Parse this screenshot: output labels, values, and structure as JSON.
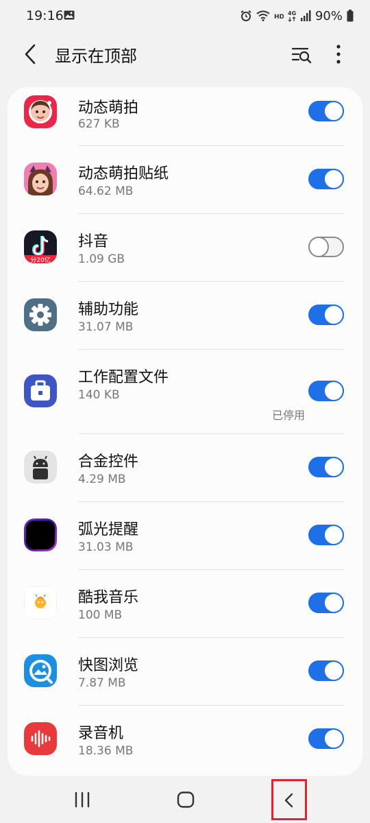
{
  "status": {
    "time": "19:16",
    "battery": "90%",
    "icons": [
      "image-icon",
      "alarm-icon",
      "wifi-icon",
      "hd-icon",
      "4g-icon",
      "signal-icon",
      "battery-icon"
    ]
  },
  "header": {
    "title": "显示在顶部",
    "back_icon": "chevron-left-icon",
    "search_icon": "list-search-icon",
    "more_icon": "more-vertical-icon"
  },
  "apps": [
    {
      "name": "动态萌拍",
      "size": "627 KB",
      "enabled": true,
      "icon": "ar-emoji-camera-icon",
      "note": ""
    },
    {
      "name": "动态萌拍贴纸",
      "size": "64.62 MB",
      "enabled": true,
      "icon": "ar-emoji-stickers-icon",
      "note": ""
    },
    {
      "name": "抖音",
      "size": "1.09 GB",
      "enabled": false,
      "icon": "douyin-icon",
      "note": ""
    },
    {
      "name": "辅助功能",
      "size": "31.07 MB",
      "enabled": true,
      "icon": "gear-icon",
      "note": ""
    },
    {
      "name": "工作配置文件",
      "size": "140 KB",
      "enabled": true,
      "icon": "briefcase-icon",
      "note": "已停用"
    },
    {
      "name": "合金控件",
      "size": "4.29 MB",
      "enabled": true,
      "icon": "android-icon",
      "note": ""
    },
    {
      "name": "弧光提醒",
      "size": "31.03 MB",
      "enabled": true,
      "icon": "edge-lighting-icon",
      "note": ""
    },
    {
      "name": "酷我音乐",
      "size": "100 MB",
      "enabled": true,
      "icon": "kuwo-music-icon",
      "note": ""
    },
    {
      "name": "快图浏览",
      "size": "7.87 MB",
      "enabled": true,
      "icon": "quickpic-icon",
      "note": ""
    },
    {
      "name": "录音机",
      "size": "18.36 MB",
      "enabled": true,
      "icon": "voice-recorder-icon",
      "note": ""
    }
  ],
  "nav": {
    "recents_icon": "recents-icon",
    "home_icon": "home-icon",
    "back_icon": "back-icon"
  },
  "colors": {
    "toggle_on": "#1f6fe6",
    "highlight_box": "#e0232e"
  }
}
